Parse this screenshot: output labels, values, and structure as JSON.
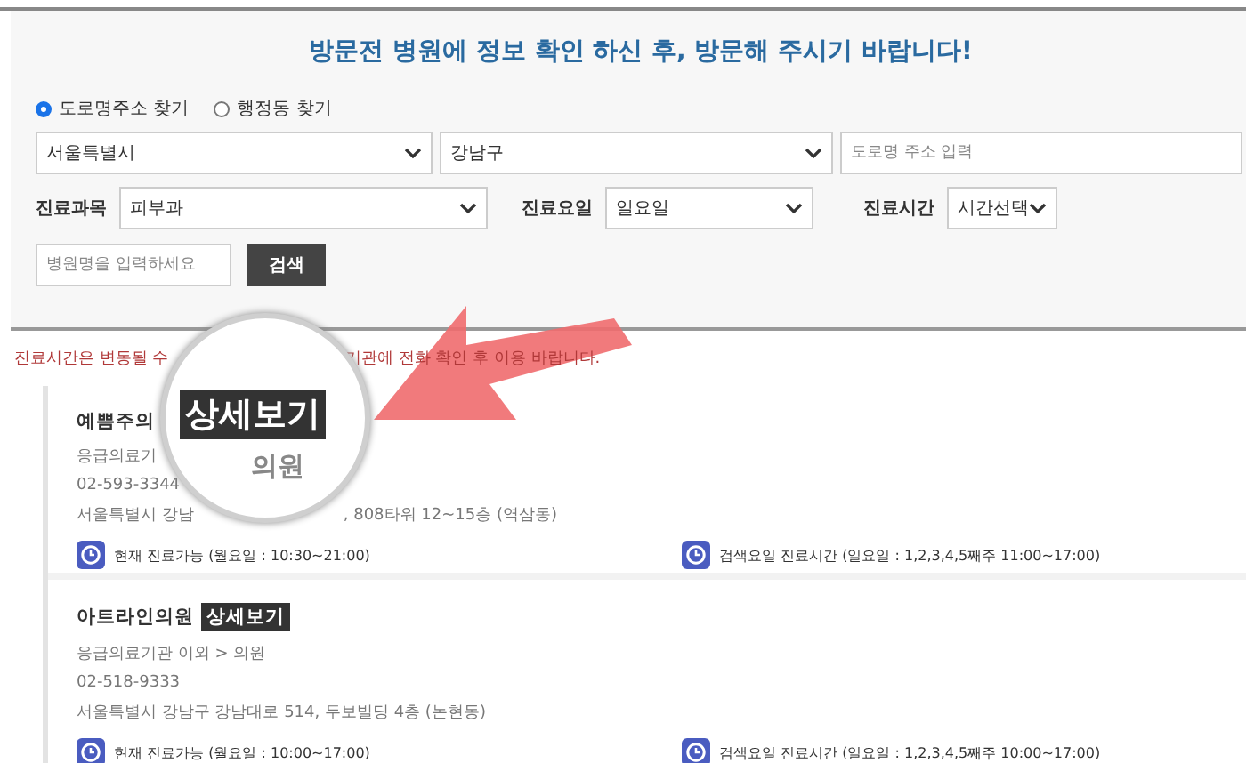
{
  "header": {
    "title": "방문전 병원에 정보 확인 하신 후, 방문해 주시기 바랍니다!"
  },
  "search_mode": [
    {
      "label": "도로명주소 찾기",
      "selected": true
    },
    {
      "label": "행정동 찾기",
      "selected": false
    }
  ],
  "address": {
    "city": "서울특별시",
    "district": "강남구",
    "road_field": {
      "placeholder": "도로명 주소 입력"
    }
  },
  "filters": [
    {
      "label": "진료과목",
      "value": "피부과"
    },
    {
      "label": "진료요일",
      "value": "일요일"
    },
    {
      "label": "진료시간",
      "value": "시간선택"
    }
  ],
  "name_field": {
    "placeholder": "병원명을 입력하세요"
  },
  "search_button": "검색",
  "notice": [
    "진료시간은 변동될 수",
    "기관에 전화 확인 후 이용 바랍니다."
  ],
  "results": [
    {
      "name": "예쁨주의",
      "category": "응급의료기",
      "phone": "02-593-3344",
      "address": [
        "서울특별시 강남",
        ", 808타워 12~15층 (역삼동)"
      ],
      "now_hours": "현재 진료가능 (월요일 : 10:30~21:00)",
      "search_hours": "검색요일 진료시간 (일요일 : 1,2,3,4,5째주 11:00~17:00)"
    },
    {
      "name": "아트라인의원",
      "detail_button": "상세보기",
      "category": "응급의료기관 이외 > 의원",
      "phone": "02-518-9333",
      "address": [
        "서울특별시 강남구 강남대로 514, 두보빌딩 4층 (논현동)"
      ],
      "now_hours": "현재 진료가능 (월요일 : 10:00~17:00)",
      "search_hours": "검색요일 진료시간 (일요일 : 1,2,3,4,5째주 10:00~17:00)"
    }
  ],
  "callout": {
    "button": "상세보기",
    "category": "의원"
  }
}
